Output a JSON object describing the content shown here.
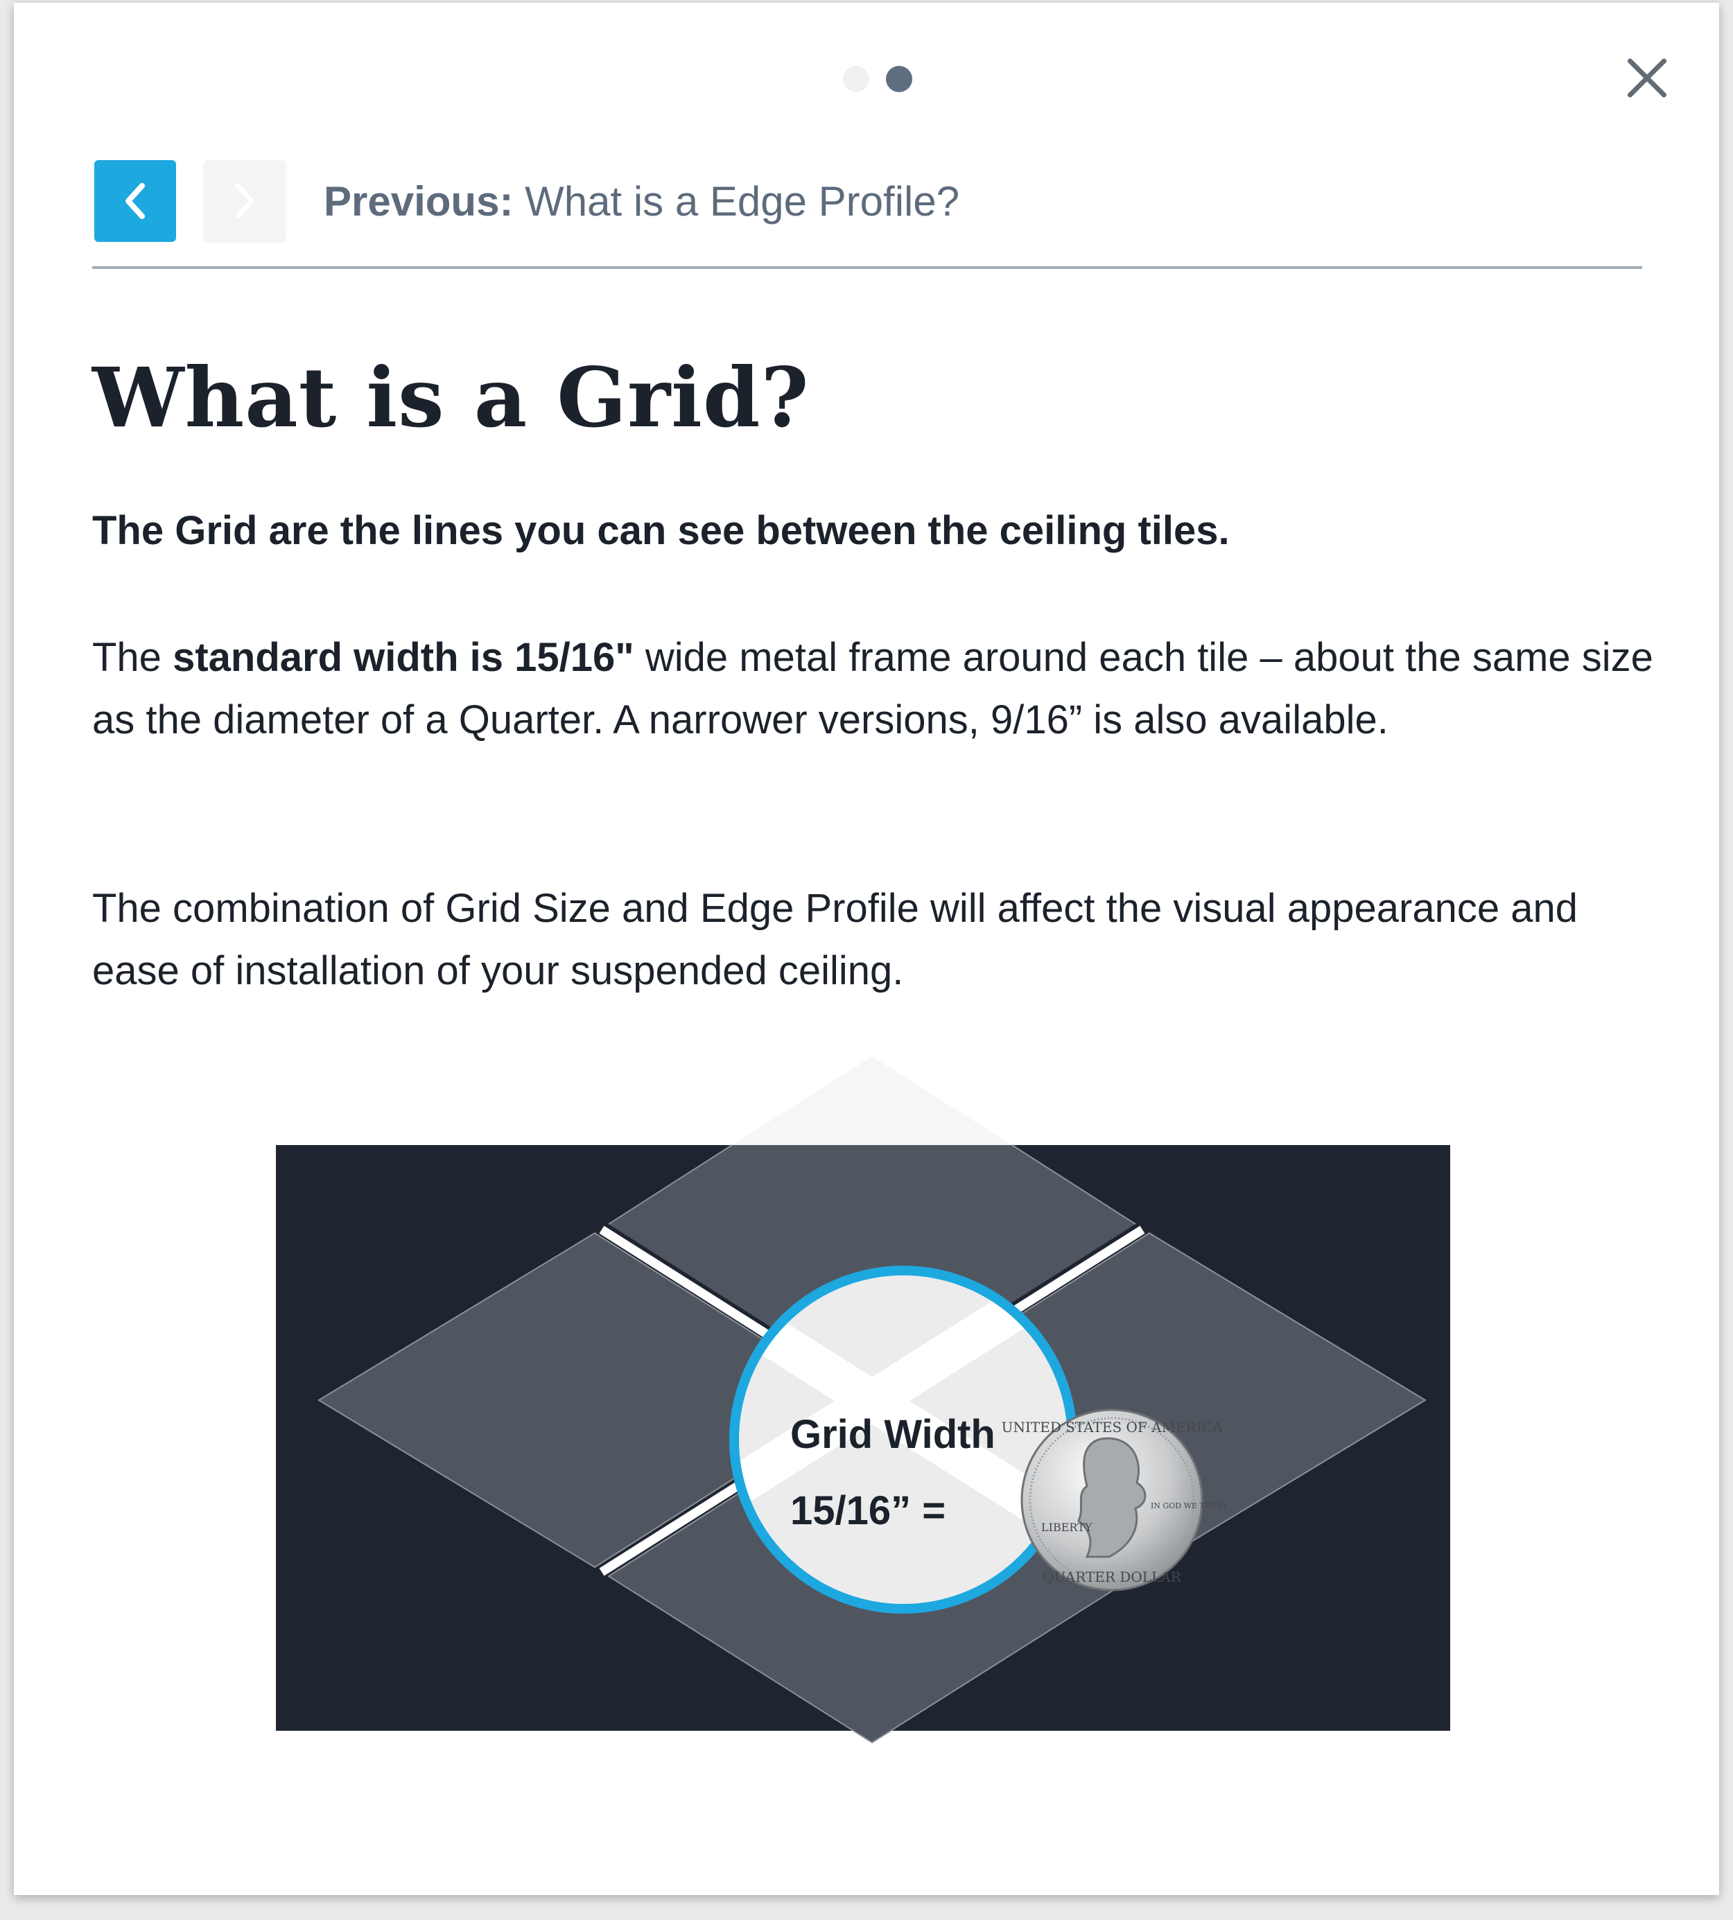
{
  "pagination": {
    "total": 2,
    "active_index": 1
  },
  "nav": {
    "prev_label": "Previous:",
    "prev_title": "What is a Edge Profile?",
    "prev_icon": "chevron-left-icon",
    "next_icon": "chevron-right-icon",
    "close_icon": "close-icon"
  },
  "content": {
    "title": "What is a Grid?",
    "lead": "The Grid are the lines you can see between the ceiling tiles.",
    "p1_before": "The ",
    "p1_bold": "standard width is 15/16\"",
    "p1_after": " wide metal frame around each tile – about the same size as the diameter of a Quarter. A narrower versions,  9/16” is also available.",
    "p2": "The combination of Grid Size and Edge Profile will affect the visual appearance and ease of installation of your suspended ceiling."
  },
  "diagram": {
    "label_line1": "Grid Width",
    "label_line2": "15/16”  =",
    "coin_top_text": "UNITED STATES OF AMERICA",
    "coin_bottom_text": "QUARTER DOLLAR",
    "coin_left_text": "LIBERTY",
    "coin_right_text": "IN GOD WE TRUST"
  },
  "colors": {
    "accent": "#1ea8e0",
    "dark_panel": "#1f2530",
    "tile": "#505660",
    "text": "#1c222b",
    "muted": "#5d6b7c"
  }
}
